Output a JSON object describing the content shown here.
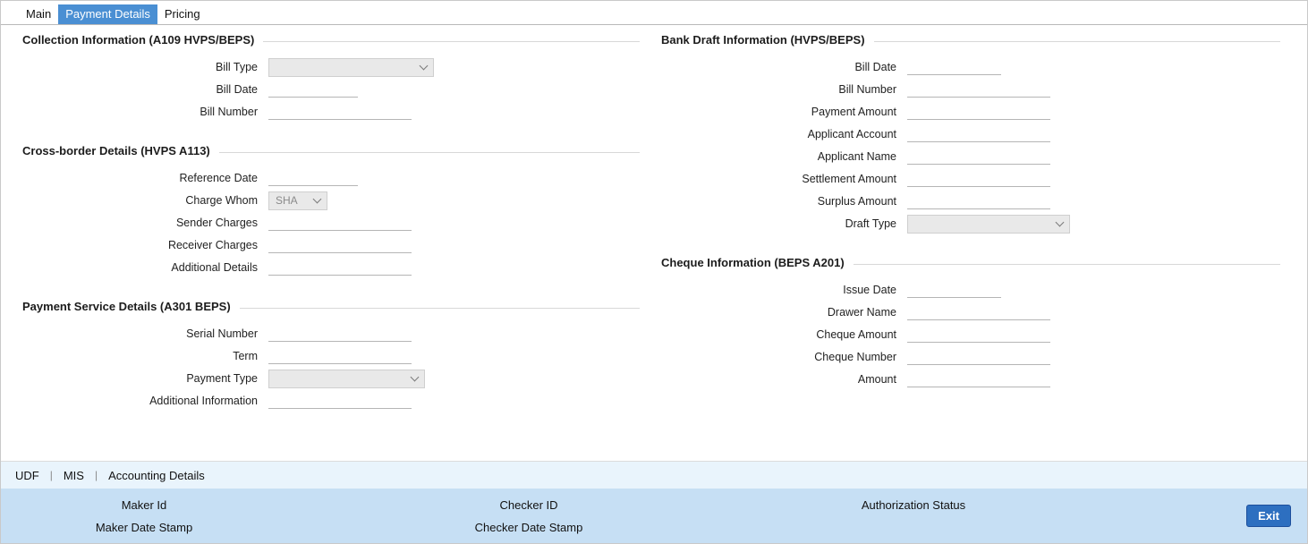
{
  "tabs": [
    {
      "label": "Main"
    },
    {
      "label": "Payment Details"
    },
    {
      "label": "Pricing"
    }
  ],
  "left": {
    "collection": {
      "title": "Collection Information (A109 HVPS/BEPS)",
      "bill_type": {
        "label": "Bill Type",
        "value": ""
      },
      "bill_date": {
        "label": "Bill Date",
        "value": ""
      },
      "bill_number": {
        "label": "Bill Number",
        "value": ""
      }
    },
    "cross_border": {
      "title": "Cross-border Details (HVPS A113)",
      "reference_date": {
        "label": "Reference Date",
        "value": ""
      },
      "charge_whom": {
        "label": "Charge Whom",
        "value": "SHA"
      },
      "sender_charges": {
        "label": "Sender Charges",
        "value": ""
      },
      "receiver_charges": {
        "label": "Receiver Charges",
        "value": ""
      },
      "additional_details": {
        "label": "Additional Details",
        "value": ""
      }
    },
    "payment_service": {
      "title": "Payment Service Details (A301 BEPS)",
      "serial_number": {
        "label": "Serial Number",
        "value": ""
      },
      "term": {
        "label": "Term",
        "value": ""
      },
      "payment_type": {
        "label": "Payment Type",
        "value": ""
      },
      "additional_information": {
        "label": "Additional Information",
        "value": ""
      }
    }
  },
  "right": {
    "bank_draft": {
      "title": "Bank Draft Information (HVPS/BEPS)",
      "bill_date": {
        "label": "Bill Date",
        "value": ""
      },
      "bill_number": {
        "label": "Bill Number",
        "value": ""
      },
      "payment_amount": {
        "label": "Payment Amount",
        "value": ""
      },
      "applicant_account": {
        "label": "Applicant Account",
        "value": ""
      },
      "applicant_name": {
        "label": "Applicant Name",
        "value": ""
      },
      "settlement_amount": {
        "label": "Settlement Amount",
        "value": ""
      },
      "surplus_amount": {
        "label": "Surplus Amount",
        "value": ""
      },
      "draft_type": {
        "label": "Draft Type",
        "value": ""
      }
    },
    "cheque": {
      "title": "Cheque Information (BEPS A201)",
      "issue_date": {
        "label": "Issue Date",
        "value": ""
      },
      "drawer_name": {
        "label": "Drawer Name",
        "value": ""
      },
      "cheque_amount": {
        "label": "Cheque Amount",
        "value": ""
      },
      "cheque_number": {
        "label": "Cheque Number",
        "value": ""
      },
      "amount": {
        "label": "Amount",
        "value": ""
      }
    }
  },
  "links": {
    "udf": "UDF",
    "mis": "MIS",
    "accounting_details": "Accounting Details",
    "separator": "|"
  },
  "footer": {
    "maker_id": "Maker Id",
    "maker_date_stamp": "Maker Date Stamp",
    "checker_id": "Checker ID",
    "checker_date_stamp": "Checker Date Stamp",
    "authorization_status": "Authorization Status",
    "exit_label": "Exit"
  },
  "colors": {
    "tab_active": "#4a8fd3",
    "links_bg": "#e9f4fc",
    "footer_bg": "#c6dff4",
    "exit_bg": "#2d6fc0"
  }
}
